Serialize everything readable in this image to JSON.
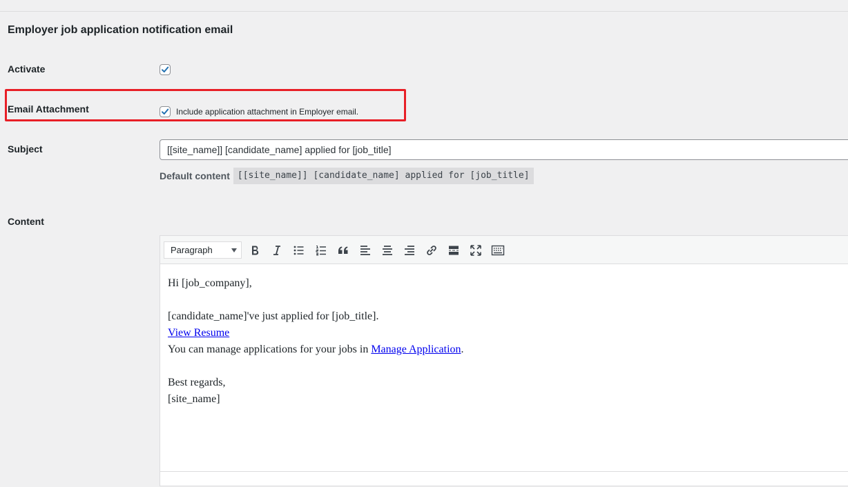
{
  "section": {
    "title": "Employer job application notification email"
  },
  "activate": {
    "label": "Activate",
    "checked": true
  },
  "email_attachment": {
    "label": "Email Attachment",
    "checked": true,
    "description": "Include application attachment in Employer email.",
    "highlight_color": "#e81f27"
  },
  "subject": {
    "label": "Subject",
    "value": "[[site_name]] [candidate_name] applied for [job_title]",
    "default_label": "Default content",
    "default_value": "[[site_name]] [candidate_name] applied for [job_title]"
  },
  "content": {
    "label": "Content",
    "toolbar": {
      "format_select": "Paragraph",
      "buttons": [
        "bold-icon",
        "italic-icon",
        "bulleted-list-icon",
        "numbered-list-icon",
        "blockquote-icon",
        "align-left-icon",
        "align-center-icon",
        "align-right-icon",
        "link-icon",
        "read-more-icon",
        "fullscreen-icon",
        "toolbar-toggle-icon"
      ]
    },
    "body": {
      "greeting": "Hi [job_company],",
      "applied_line": "[candidate_name]'ve just applied for [job_title].",
      "view_resume_link": "View Resume",
      "manage_prefix": "You can manage applications for your jobs in ",
      "manage_link": "Manage Application",
      "manage_suffix": ".",
      "regards": "Best regards,",
      "signature": "[site_name]"
    }
  },
  "colors": {
    "background": "#f0f0f1",
    "checkbox_check": "#2271b1",
    "link": "#0000ee"
  }
}
